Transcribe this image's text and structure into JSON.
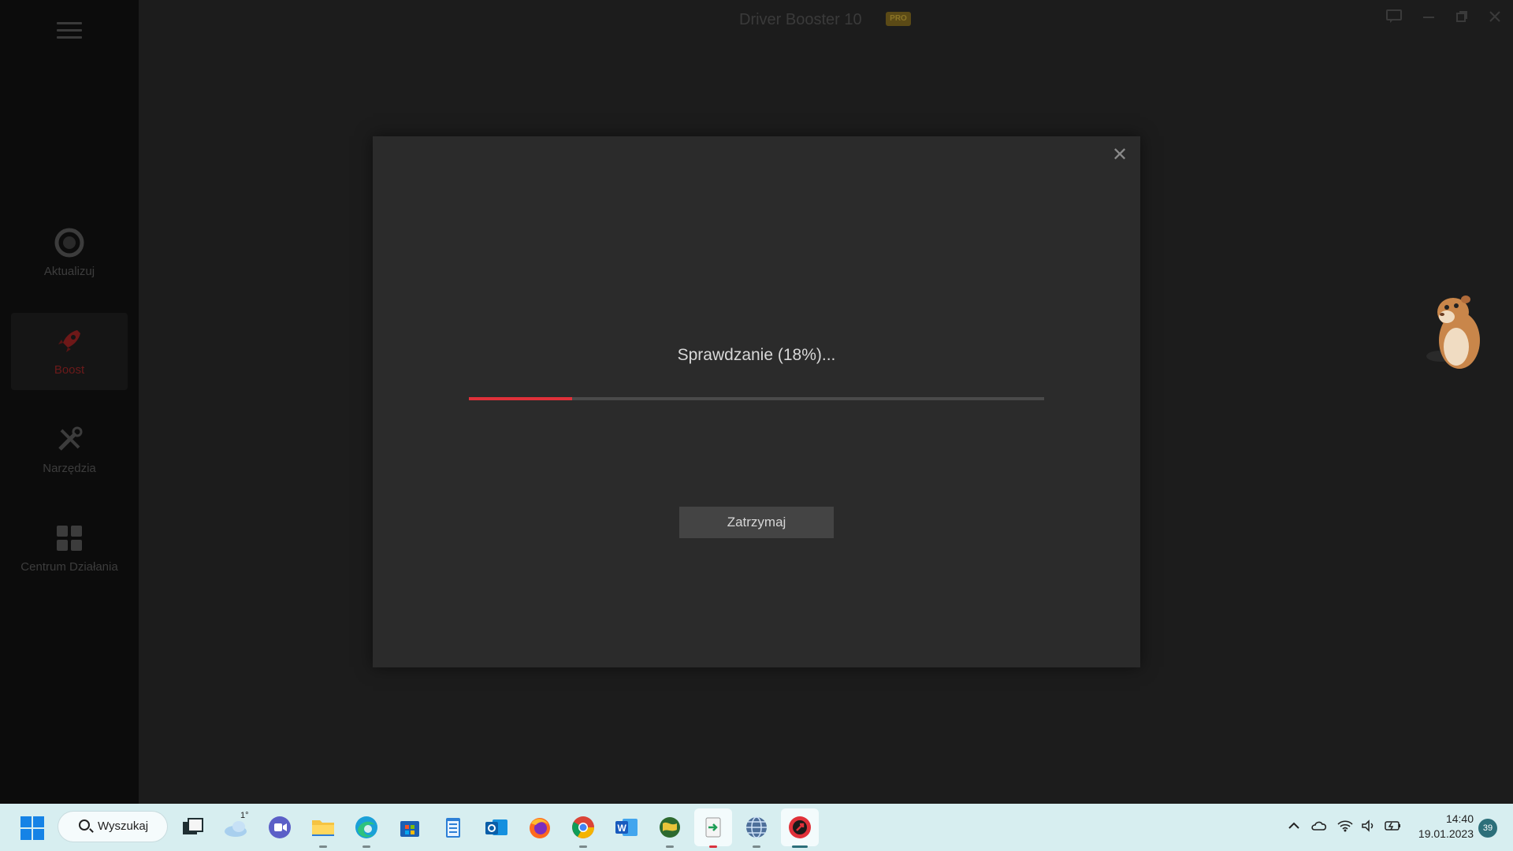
{
  "app": {
    "title": "Driver Booster 10",
    "badge": "PRO",
    "sidebar": {
      "items": [
        {
          "label": "Aktualizuj",
          "icon": "update-ring-icon"
        },
        {
          "label": "Boost",
          "icon": "rocket-icon",
          "active": true
        },
        {
          "label": "Narzędzia",
          "icon": "tools-icon"
        },
        {
          "label": "Centrum Działania",
          "icon": "grid-icon"
        }
      ]
    }
  },
  "dialog": {
    "status": "Sprawdzanie (18%)...",
    "progress_percent": 18,
    "stop_label": "Zatrzymaj",
    "close_glyph": "✕"
  },
  "taskbar": {
    "search_label": "Wyszukaj",
    "weather_temp": "1°",
    "time": "14:40",
    "date": "19.01.2023",
    "notification_count": "39"
  },
  "colors": {
    "accent": "#e0313a",
    "taskbar": "#d7eef0"
  }
}
